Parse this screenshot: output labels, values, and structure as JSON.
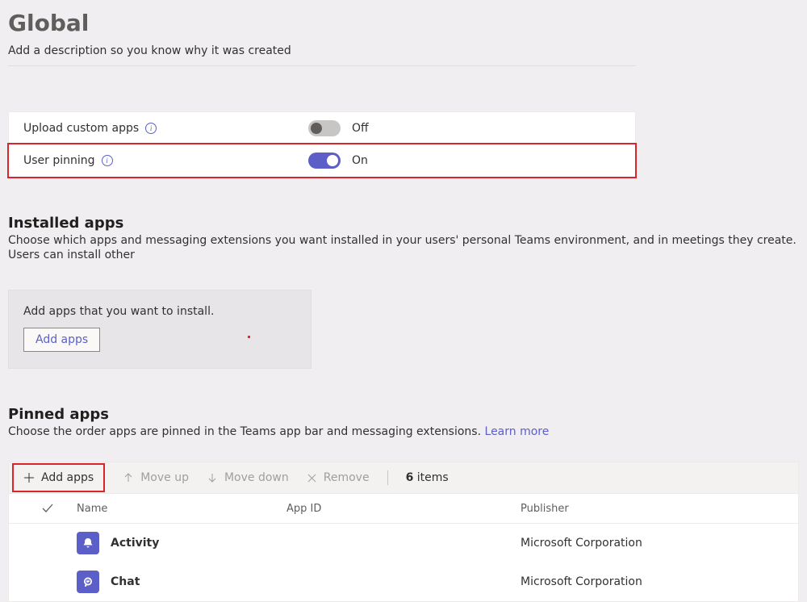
{
  "header": {
    "title": "Global",
    "description": "Add a description so you know why it was created"
  },
  "toggles": {
    "upload": {
      "label": "Upload custom apps",
      "state": "Off",
      "on": false
    },
    "pinning": {
      "label": "User pinning",
      "state": "On",
      "on": true
    }
  },
  "installed": {
    "title": "Installed apps",
    "sub": "Choose which apps and messaging extensions you want installed in your users' personal Teams environment, and in meetings they create. Users can install other",
    "box_msg": "Add apps that you want to install.",
    "add_btn": "Add apps"
  },
  "pinned": {
    "title": "Pinned apps",
    "sub_text": "Choose the order apps are pinned in the Teams app bar and messaging extensions. ",
    "learn_more": "Learn more",
    "toolbar": {
      "add": "Add apps",
      "move_up": "Move up",
      "move_down": "Move down",
      "remove": "Remove",
      "count": "6",
      "count_suffix": " items"
    },
    "columns": {
      "name": "Name",
      "app_id": "App ID",
      "publisher": "Publisher"
    },
    "rows": [
      {
        "name": "Activity",
        "app_id": "",
        "publisher": "Microsoft Corporation",
        "icon": "bell"
      },
      {
        "name": "Chat",
        "app_id": "",
        "publisher": "Microsoft Corporation",
        "icon": "chat"
      }
    ]
  }
}
